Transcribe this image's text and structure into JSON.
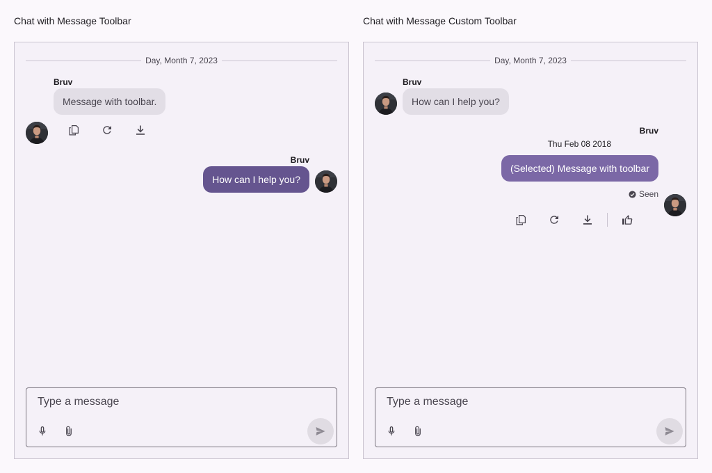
{
  "left_panel": {
    "title": "Chat with Message Toolbar",
    "date_separator": "Day, Month 7, 2023",
    "messages": [
      {
        "sender": "Bruv",
        "text": "Message with toolbar.",
        "direction": "incoming"
      },
      {
        "sender": "Bruv",
        "text": "How can I help you?",
        "direction": "outgoing"
      }
    ],
    "toolbar": [
      "copy-icon",
      "refresh-icon",
      "download-icon"
    ],
    "composer": {
      "placeholder": "Type a message"
    }
  },
  "right_panel": {
    "title": "Chat with Message Custom Toolbar",
    "date_separator": "Day, Month 7, 2023",
    "messages": [
      {
        "sender": "Bruv",
        "text": "How can I help you?",
        "direction": "incoming"
      },
      {
        "sender": "Bruv",
        "timestamp": "Thu Feb 08 2018",
        "text": "(Selected) Message with toolbar",
        "direction": "outgoing",
        "status": "Seen"
      }
    ],
    "toolbar": [
      "copy-icon",
      "refresh-icon",
      "download-icon",
      "thumbs-up-icon"
    ],
    "composer": {
      "placeholder": "Type a message"
    }
  },
  "colors": {
    "outgoing_bubble": "#65558f",
    "selected_bubble": "#7b68a6",
    "incoming_bubble": "#e2dee6",
    "panel_background": "#f5f1f8"
  }
}
